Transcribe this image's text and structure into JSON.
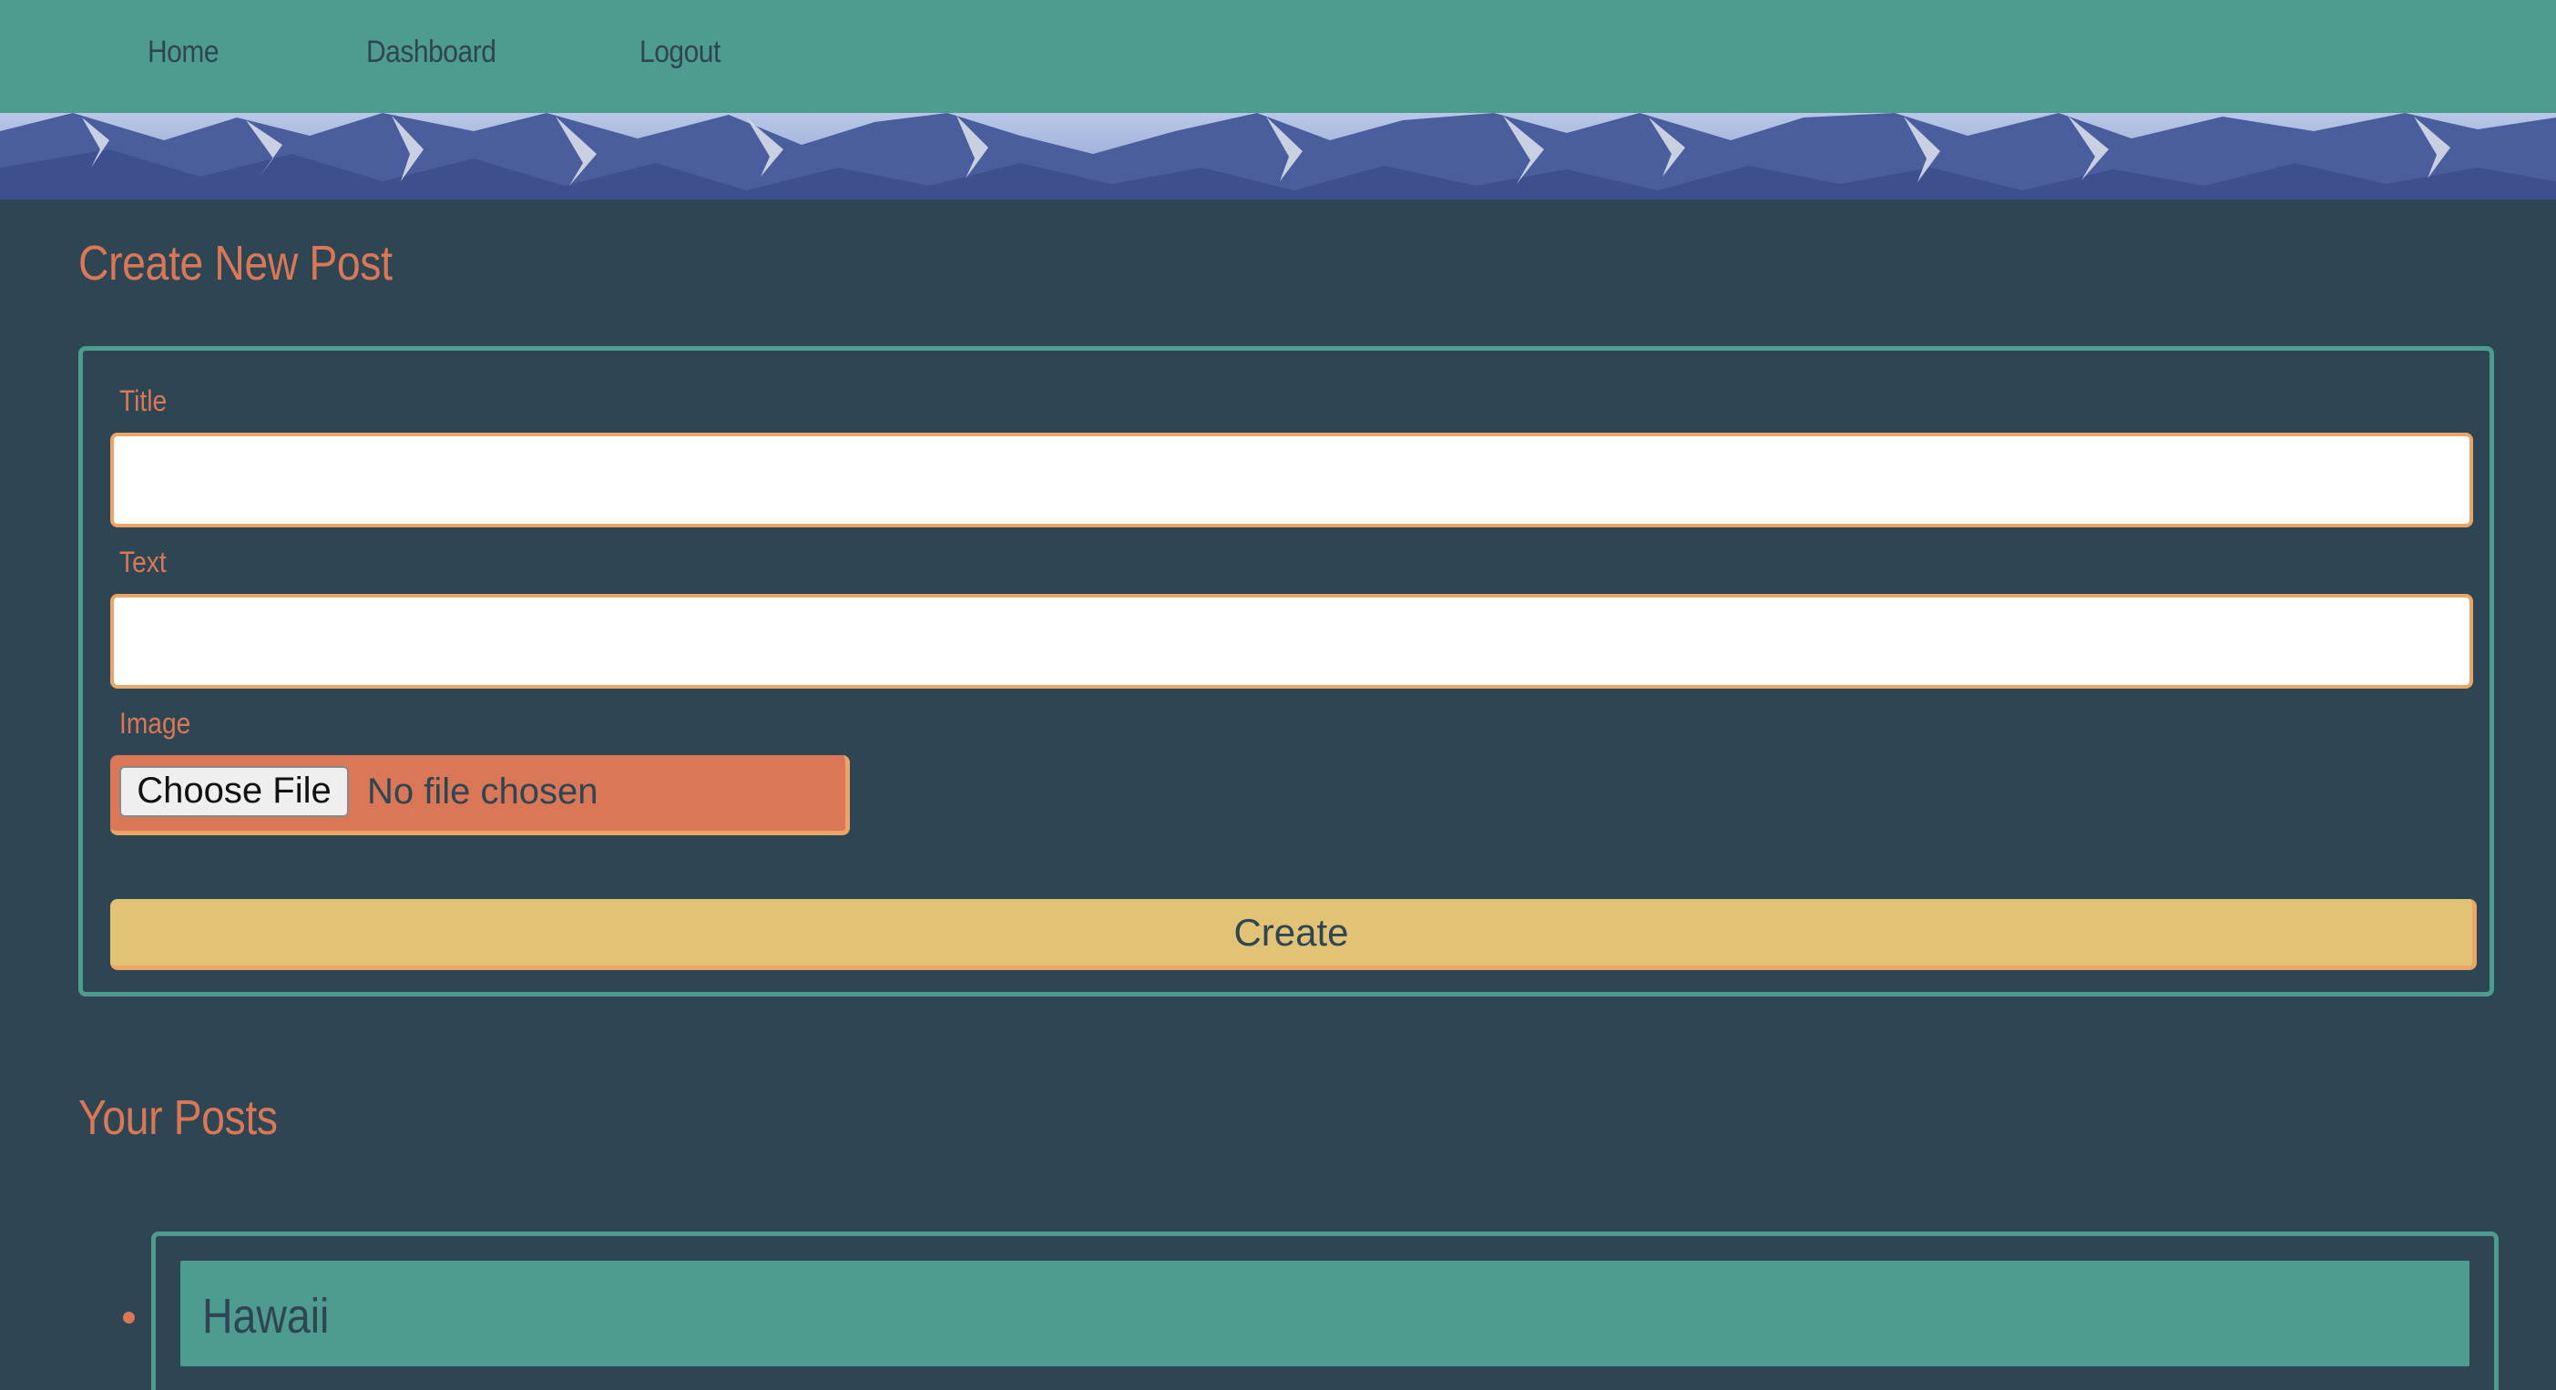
{
  "nav": {
    "links": [
      {
        "label": "Home"
      },
      {
        "label": "Dashboard"
      },
      {
        "label": "Logout"
      }
    ]
  },
  "banner": {
    "image": "mountain-banner"
  },
  "create_section": {
    "heading": "Create New Post",
    "title_label": "Title",
    "title_value": "",
    "text_label": "Text",
    "text_value": "",
    "image_label": "Image",
    "file_button_label": "Choose File",
    "file_status": "No file chosen",
    "submit_label": "Create"
  },
  "posts_section": {
    "heading": "Your Posts",
    "posts": [
      {
        "title": "Hawaii"
      }
    ]
  },
  "colors": {
    "background": "#2e4553",
    "nav": "#4e9b8f",
    "accent": "#d97757",
    "input_border": "#eba566",
    "button": "#e2c275"
  }
}
